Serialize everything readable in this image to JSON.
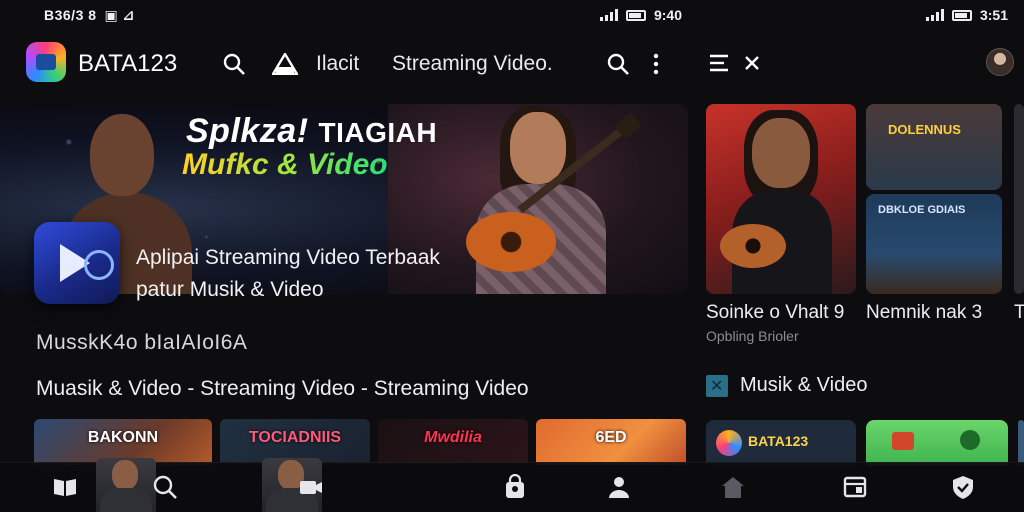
{
  "status_bar": {
    "left_text": "B36/3 8",
    "time_main": "9:40",
    "time_right": "3:51"
  },
  "app_bar": {
    "brand": "BATA123",
    "menu_item_1": "Ilacit",
    "menu_item_2": "Streaming Video."
  },
  "hero": {
    "title_line1": "Splkza!",
    "title_line1_alt": "TIAGIAH",
    "title_line2": "Mufkc & Video",
    "subtitle_line1": "Aplipai Streaming Video Terbaak",
    "subtitle_line2": "patur Musik & Video"
  },
  "sections": {
    "heading_1": "MusskK4o  bIaIAIoI6A",
    "heading_2": "Muasik & Video - Streaming Video   - Streaming Video"
  },
  "thumbnails": [
    {
      "label": "BAKONN"
    },
    {
      "label": "TOCIADNIIS"
    },
    {
      "label": "Mwdilia"
    },
    {
      "label": "6ED"
    }
  ],
  "right_panel": {
    "r2_label": "DOLENNUS",
    "r3_label": "DBKLOE  GDIAIS",
    "caption_1": "Soinke o  Vhalt 9",
    "caption_1_sub": "Opbling Brioler",
    "caption_2": "Nemnik nak 3",
    "caption_3": "T",
    "section_title": "Musik & Video",
    "card_1_label": "BATA123"
  },
  "colors": {
    "background": "#0d0d0f",
    "accent_gradient_start": "#ffd027",
    "accent_gradient_end": "#24e07a",
    "play_tile": "#2f4cdb"
  },
  "icons": {
    "app_bar": [
      "search-icon",
      "triangle-logo-icon",
      "search-icon",
      "more-vertical-icon"
    ],
    "right_bar": [
      "menu-icon",
      "close-icon",
      "avatar"
    ],
    "bottom_nav": [
      "book-icon",
      "search-icon",
      "camera-icon",
      "bag-icon",
      "person-icon",
      "home-icon",
      "library-icon",
      "shield-icon"
    ]
  }
}
